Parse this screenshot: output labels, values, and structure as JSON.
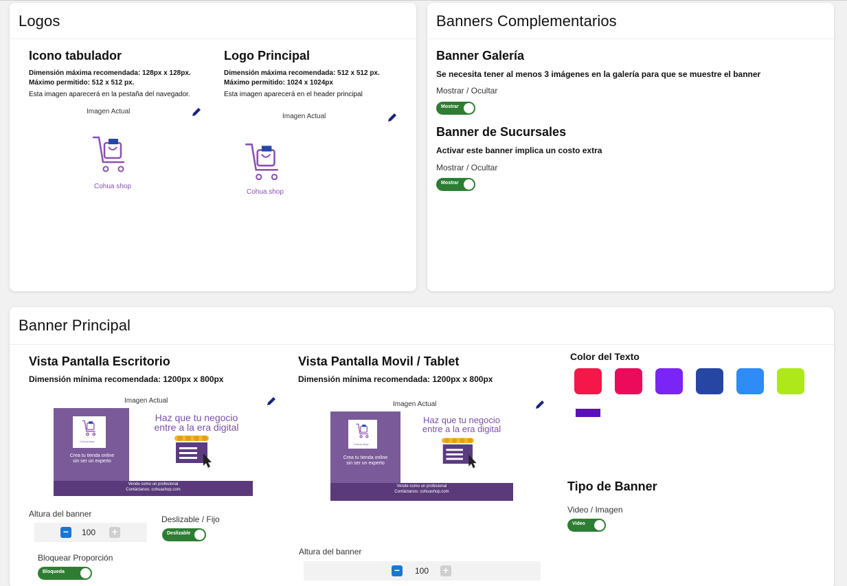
{
  "logos": {
    "title": "Logos",
    "tab_icon": {
      "title": "Icono tabulador",
      "line1": "Dimensión máxima recomendada: 128px x 128px.",
      "line2": "Máximo permitido: 512 x 512 px.",
      "line3": "Esta imagen aparecerá en la pestaña del navegador.",
      "current_label": "Imagen Actual",
      "logo_text": "Cohua shop"
    },
    "main_logo": {
      "title": "Logo Principal",
      "line1": "Dimensión máxima recomendada: 512 x 512 px.",
      "line2": "Máximo permitido: 1024 x 1024px",
      "line3": "Esta imagen aparecerá en el header principal",
      "current_label": "Imagen Actual",
      "logo_text": "Cohua shop"
    }
  },
  "complementary": {
    "title": "Banners Complementarios",
    "gallery": {
      "title": "Banner Galería",
      "desc": "Se necesita tener al menos 3 imágenes en la galería para que se muestre el banner",
      "show_hide_label": "Mostrar / Ocultar",
      "toggle_label": "Mostrar"
    },
    "branches": {
      "title": "Banner de Sucursales",
      "desc": "Activar este banner implica un costo extra",
      "show_hide_label": "Mostrar / Ocultar",
      "toggle_label": "Mostrar"
    }
  },
  "main_banner": {
    "title": "Banner Principal",
    "desktop": {
      "title": "Vista Pantalla Escritorio",
      "dimension": "Dimensión mínima recomendada: 1200px x 800px",
      "current_label": "Imagen Actual",
      "height_label": "Altura del banner",
      "height_value": "100",
      "slide_label": "Deslizable / Fijo",
      "slide_toggle": "Deslizable",
      "lock_label": "Bloquear Proporción",
      "lock_toggle": "Bloqueda"
    },
    "mobile": {
      "title": "Vista Pantalla Movil / Tablet",
      "dimension": "Dimensión mínima recomendada: 1200px x 800px",
      "current_label": "Imagen Actual",
      "height_label": "Altura del banner",
      "height_value": "100"
    },
    "banner_image": {
      "headline_1": "Haz que tu negocio",
      "headline_2": "entre a la era digital",
      "left_1": "Crea tu tienda online",
      "left_2": "sin ser un experto",
      "logo_small": "Cohua shop",
      "footer_1": "Vende como un profesional",
      "footer_2": "Contáctanos: cohuashop.com"
    },
    "text_color": {
      "label": "Color del Texto",
      "swatches": [
        "#f5174a",
        "#ec0a5a",
        "#7a25f5",
        "#2746a3",
        "#2f8bf5",
        "#aee81a"
      ],
      "selected": "#5b10b8"
    },
    "banner_type": {
      "title": "Tipo de Banner",
      "label": "Video / Imagen",
      "toggle": "Video"
    }
  },
  "colors": {
    "toggle_on": "#2e7d32",
    "banner_purple": "#7a5a98",
    "banner_footer": "#5a3a7a",
    "logo_purple": "#8a4fb3",
    "pencil_blue": "#1a237e",
    "stepper_blue": "#1976d2"
  },
  "icons": [
    "pencil-icon",
    "shopping-cart-icon",
    "minus-icon",
    "plus-icon"
  ]
}
